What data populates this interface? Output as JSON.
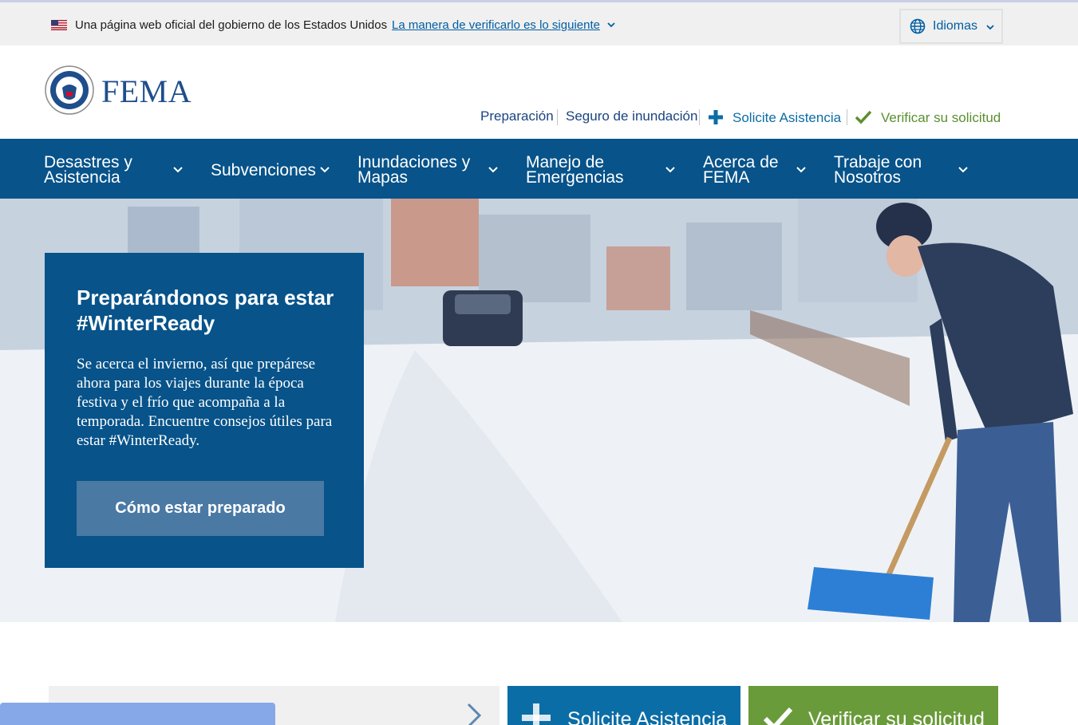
{
  "gov_banner": {
    "text": "Una página web oficial del gobierno de los Estados Unidos",
    "link": "La manera de verificarlo es lo siguiente",
    "language_button": "Idiomas"
  },
  "header": {
    "logo": "FEMA",
    "utility_nav": [
      "Preparación",
      "Seguro de inundación",
      "Solicite Asistencia",
      "Verificar su solicitud"
    ]
  },
  "main_nav": [
    {
      "line1": "Desastres y",
      "line2": "Asistencia"
    },
    {
      "line1": "Subvenciones",
      "line2": ""
    },
    {
      "line1": "Inundaciones y",
      "line2": "Mapas"
    },
    {
      "line1": "Manejo de",
      "line2": "Emergencias"
    },
    {
      "line1": "Acerca de",
      "line2": "FEMA"
    },
    {
      "line1": "Trabaje con",
      "line2": "Nosotros"
    }
  ],
  "hero": {
    "title": "Preparándonos para estar #WinterReady",
    "body": "Se acerca el invierno, así que prepárese ahora para los viajes durante la época festiva y el frío que acompaña a la temporada. Encuentre consejos útiles para estar #WinterReady.",
    "button": "Cómo estar preparado"
  },
  "bottom_cards": {
    "apply": "Solicite Asistencia",
    "verify": "Verificar su solicitud"
  },
  "colors": {
    "nav_blue": "#07538a",
    "link_blue": "#005ea2",
    "accent_green": "#6a9b3a",
    "button_blue": "#4a79a4"
  }
}
